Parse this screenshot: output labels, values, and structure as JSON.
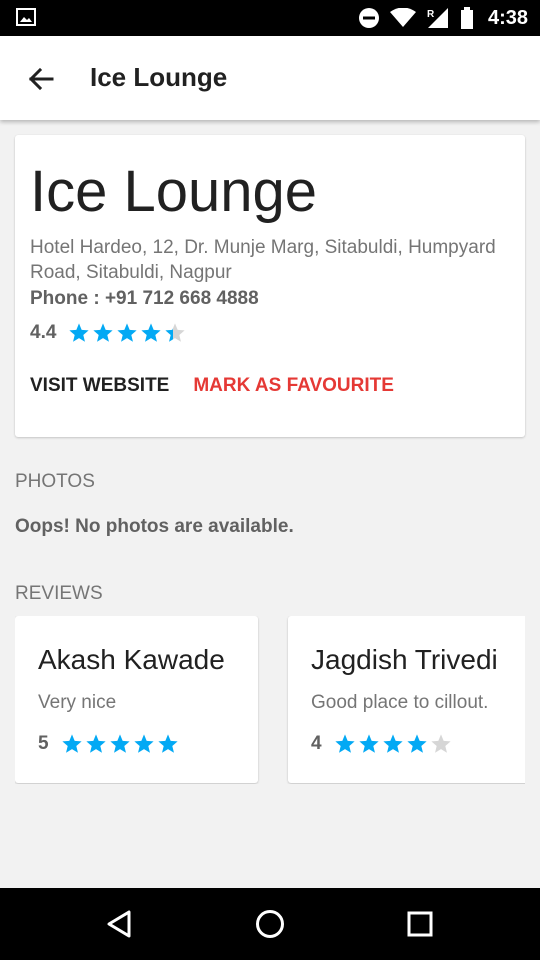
{
  "status_bar": {
    "time": "4:38",
    "signal_label": "R"
  },
  "app_bar": {
    "title": "Ice Lounge"
  },
  "place": {
    "name": "Ice Lounge",
    "address": "Hotel Hardeo, 12, Dr. Munje Marg, Sitabuldi, Humpyard Road, Sitabuldi, Nagpur",
    "phone": "Phone : +91 712 668 4888",
    "rating_text": "4.4",
    "rating": 4.4,
    "actions": {
      "visit": "VISIT WEBSITE",
      "favourite": "MARK AS FAVOURITE"
    }
  },
  "photos": {
    "header": "PHOTOS",
    "empty_message": "Oops! No photos are available."
  },
  "reviews": {
    "header": "REVIEWS",
    "items": [
      {
        "author": "Akash Kawade",
        "text": "Very nice",
        "rating_text": "5",
        "rating": 5
      },
      {
        "author": "Jagdish Trivedi",
        "text": "Good place to cillout.",
        "rating_text": "4",
        "rating": 4
      }
    ]
  },
  "colors": {
    "star_filled": "#03a9f4",
    "star_empty": "#d6d6d6",
    "favourite": "#e53935"
  },
  "icons": [
    "gallery-icon",
    "do-not-disturb-icon",
    "wifi-icon",
    "signal-icon",
    "battery-icon",
    "back-arrow-icon",
    "nav-back-icon",
    "nav-home-icon",
    "nav-recents-icon"
  ]
}
